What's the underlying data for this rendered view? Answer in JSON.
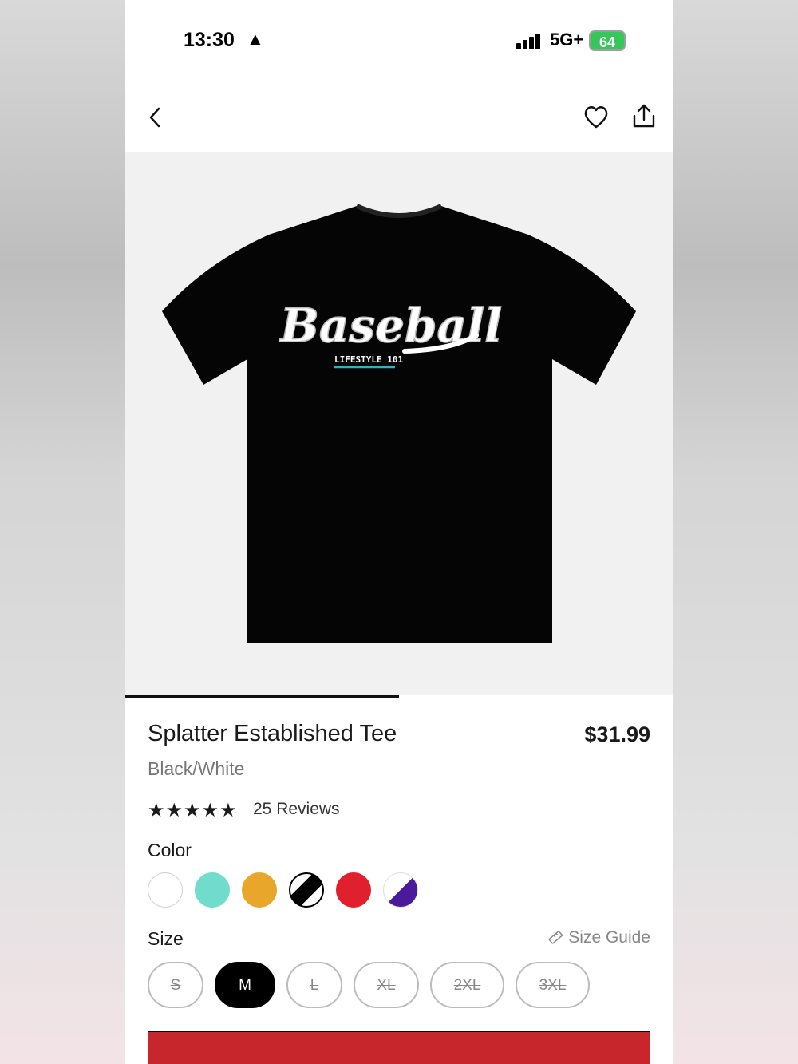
{
  "status_bar": {
    "time": "13:30",
    "network": "5G+",
    "battery": "64"
  },
  "nav": {
    "back_icon": "chevron-left-icon",
    "favorite_icon": "heart-icon",
    "share_icon": "share-icon"
  },
  "product_image": {
    "graphic_text": "Baseball",
    "graphic_subtext": "LIFESTYLE 101",
    "carousel_progress": 0.5
  },
  "product": {
    "title": "Splatter Established Tee",
    "price": "$31.99",
    "variant": "Black/White",
    "stars": "★★★★★",
    "rating": 5,
    "reviews": "25 Reviews"
  },
  "color": {
    "label": "Color",
    "swatches": [
      "#ffffff",
      "#6fdccc",
      "#e8a72b",
      "black-white-split",
      "#e0202c",
      "purple-white-split"
    ]
  },
  "size": {
    "label": "Size",
    "guide": "Size Guide",
    "options": [
      "S",
      "M",
      "L",
      "XL",
      "2XL",
      "3XL"
    ],
    "selected": "M"
  },
  "colors": {
    "accent": "#c7262d",
    "selected_size_bg": "#000000"
  }
}
